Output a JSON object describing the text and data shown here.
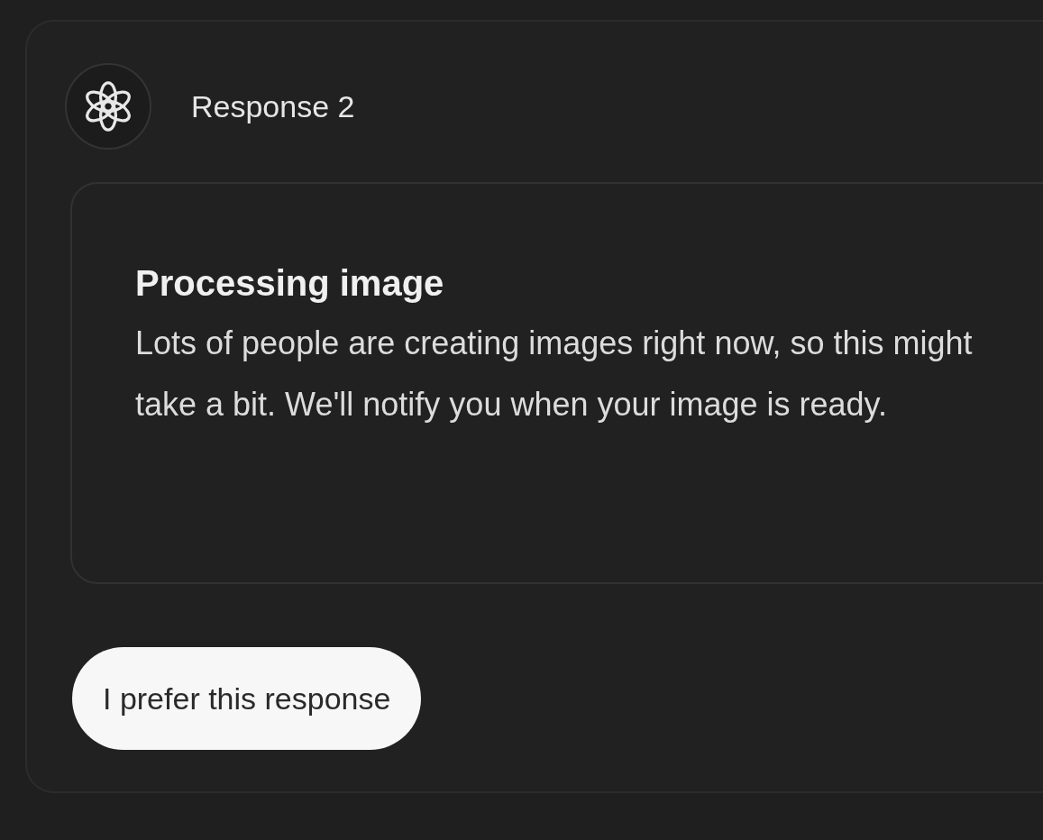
{
  "response": {
    "title": "Response 2"
  },
  "notice": {
    "title": "Processing image",
    "body": "Lots of people are creating images right now, so this might take a bit. We'll notify you when your image is ready."
  },
  "prefer_button": {
    "label": "I prefer this response"
  }
}
